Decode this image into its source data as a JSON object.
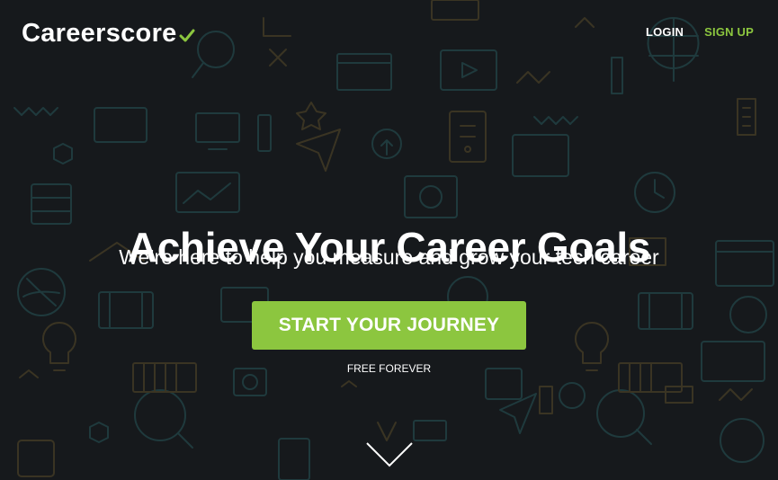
{
  "brand": {
    "name": "Careerscore",
    "accent_color": "#8cc63f",
    "background_color": "#16191c"
  },
  "nav": {
    "login": "LOGIN",
    "signup": "SIGN UP"
  },
  "hero": {
    "headline": "Achieve Your Career Goals",
    "subheadline": "We’re here to help you measure and grow your tech career",
    "cta_label": "START YOUR JOURNEY",
    "cta_note": "FREE FOREVER"
  },
  "icons": {
    "background_pattern": "tech-icon-pattern",
    "scroll": "chevron-down-icon"
  }
}
